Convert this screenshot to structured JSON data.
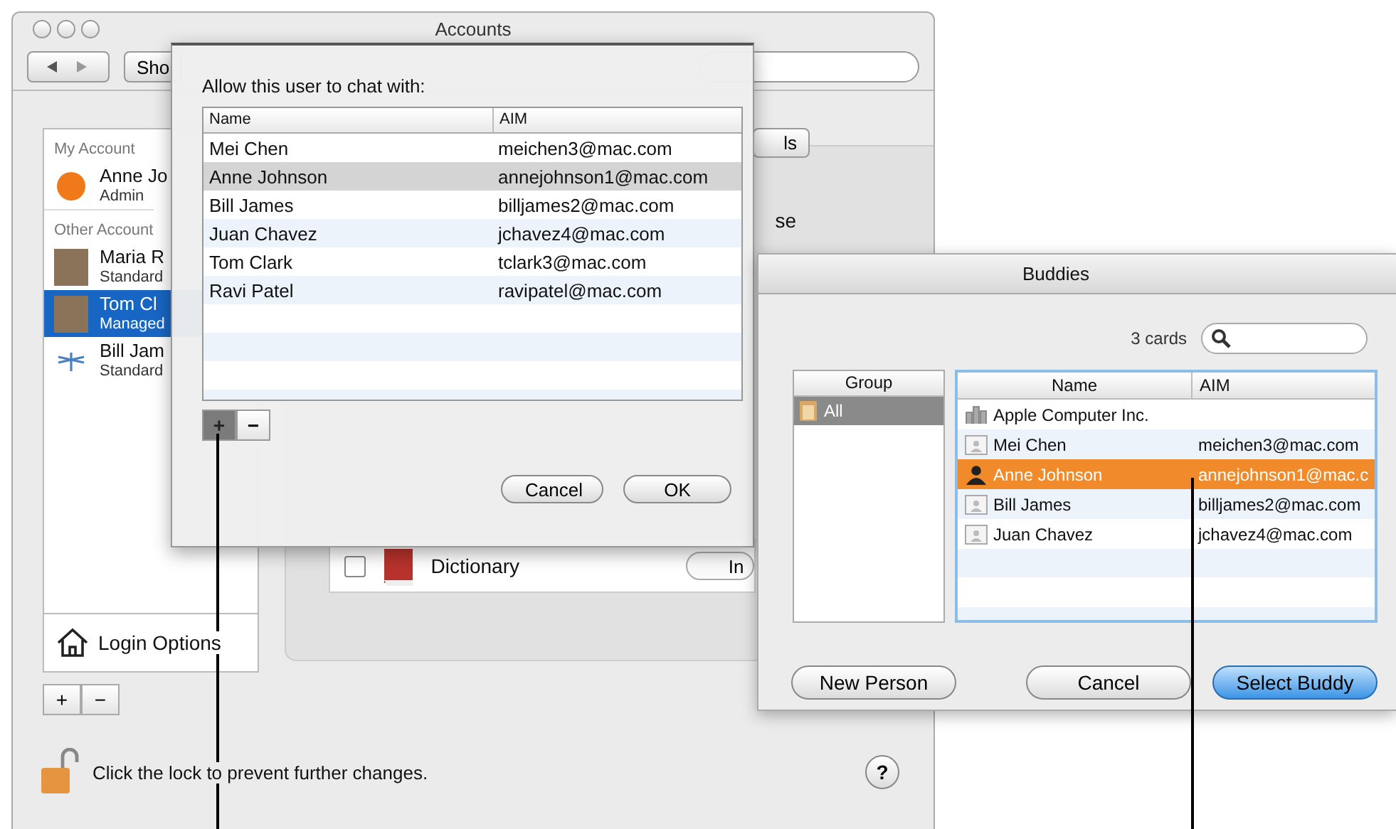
{
  "accounts_window": {
    "title": "Accounts",
    "toolbar": {
      "show_all_button": "Sho"
    },
    "sidebar": {
      "sections": [
        {
          "header": "My Account",
          "items": [
            {
              "name": "Anne Jo",
              "role": "Admin",
              "kind": "ball",
              "selected": false
            }
          ]
        },
        {
          "header": "Other Account",
          "items": [
            {
              "name": "Maria R",
              "role": "Standard",
              "kind": "photo",
              "selected": false
            },
            {
              "name": "Tom Cl",
              "role": "Managed",
              "kind": "photo",
              "selected": true
            },
            {
              "name": "Bill Jam",
              "role": "Standard",
              "kind": "dragonfly",
              "selected": false
            }
          ]
        }
      ],
      "login_options": "Login Options"
    },
    "account_buttons": [
      "+",
      "−"
    ],
    "panel": {
      "tab_fragment": "ls",
      "text_fragment": "se",
      "app_row": {
        "label": "Dictionary",
        "checked": false,
        "button": "In"
      }
    },
    "lock_text": "Click the lock to prevent further changes.",
    "help_button": "?"
  },
  "sheet": {
    "prompt": "Allow this user to chat with:",
    "columns": [
      "Name",
      "AIM"
    ],
    "rows": [
      {
        "name": "Mei Chen",
        "aim": "meichen3@mac.com",
        "selected": false
      },
      {
        "name": "Anne Johnson",
        "aim": "annejohnson1@mac.com",
        "selected": true
      },
      {
        "name": "Bill James",
        "aim": "billjames2@mac.com",
        "selected": false
      },
      {
        "name": "Juan Chavez",
        "aim": "jchavez4@mac.com",
        "selected": false
      },
      {
        "name": "Tom Clark",
        "aim": "tclark3@mac.com",
        "selected": false
      },
      {
        "name": "Ravi Patel",
        "aim": "ravipatel@mac.com",
        "selected": false
      }
    ],
    "list_buttons": [
      {
        "label": "+",
        "pressed": true
      },
      {
        "label": "−",
        "pressed": false
      }
    ],
    "buttons": [
      "Cancel",
      "OK"
    ]
  },
  "buddies": {
    "title": "Buddies",
    "count": "3 cards",
    "group_column": "Group",
    "groups": [
      {
        "label": "All",
        "selected": true
      }
    ],
    "columns": [
      "Name",
      "AIM"
    ],
    "rows": [
      {
        "name": "Apple Computer Inc.",
        "kind": "company",
        "selected": false
      },
      {
        "name": "Mei Chen",
        "aim": "meichen3@mac.com",
        "kind": "person",
        "selected": false
      },
      {
        "name": "Anne Johnson",
        "aim": "annejohnson1@mac.c",
        "kind": "person",
        "selected": true
      },
      {
        "name": "Bill James",
        "aim": "billjames2@mac.com",
        "kind": "person",
        "selected": false
      },
      {
        "name": "Juan Chavez",
        "aim": "jchavez4@mac.com",
        "kind": "person",
        "selected": false
      }
    ],
    "buttons": [
      {
        "label": "New Person",
        "default": false
      },
      {
        "label": "Cancel",
        "default": false
      },
      {
        "label": "Select Buddy",
        "default": true
      }
    ]
  }
}
